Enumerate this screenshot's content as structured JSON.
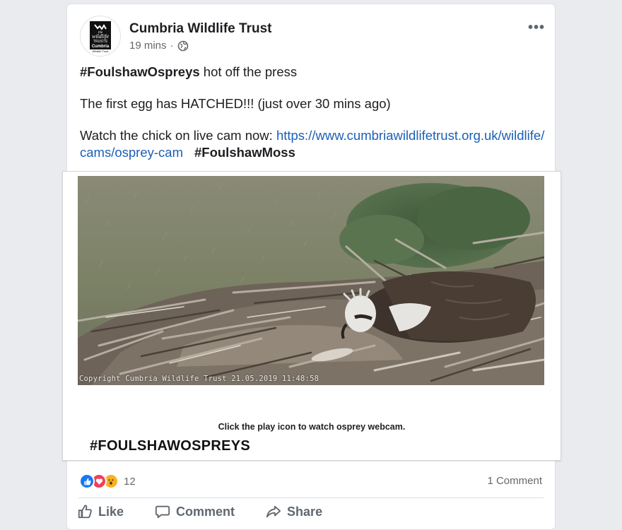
{
  "post": {
    "page_name": "Cumbria Wildlife Trust",
    "time": "19 mins",
    "separator": "·",
    "avatar_logo": {
      "line1": "the",
      "line2": "wildlife",
      "line3": "TRUSTS",
      "line4": "Cumbria",
      "line5": "Wildlife Trust"
    },
    "more_label": "•••",
    "text": {
      "hashtag1": "#FoulshawOspreys",
      "line1_rest": " hot off the press",
      "line2": "The first egg has HATCHED!!! (just over 30 mins ago)",
      "line3_prefix": "Watch the chick on live cam now: ",
      "link": "https://www.cumbriawildlifetrust.org.uk/wildlife/cams/osprey-cam",
      "hashtag2": "#FoulshawMoss"
    }
  },
  "attachment": {
    "image_copyright": "Copyright Cumbria Wildlife Trust 21.05.2019 11:48:58",
    "caption": "Click the play icon to watch osprey webcam.",
    "big_hashtag": "#FOULSHAWOSPREYS"
  },
  "footer": {
    "reactions": [
      "like",
      "love",
      "wow"
    ],
    "reaction_count": "12",
    "comments_count": "1 Comment",
    "actions": {
      "like": "Like",
      "comment": "Comment",
      "share": "Share"
    }
  },
  "colors": {
    "link": "#1b5fb7",
    "like": "#1877f2",
    "love": "#f33e58",
    "wow": "#f7b125",
    "muted": "#65676b"
  }
}
